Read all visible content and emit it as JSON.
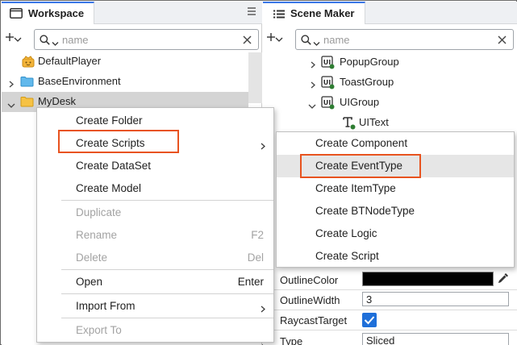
{
  "workspace": {
    "tab_label": "Workspace",
    "search_placeholder": "name",
    "tree": [
      {
        "label": "DefaultPlayer",
        "icon": "player-icon",
        "expandable": false
      },
      {
        "label": "BaseEnvironment",
        "icon": "folder-blue-icon",
        "expandable": true,
        "expanded": false
      },
      {
        "label": "MyDesk",
        "icon": "folder-yellow-icon",
        "expandable": true,
        "expanded": true,
        "selected": true
      }
    ]
  },
  "scene_maker": {
    "tab_label": "Scene Maker",
    "search_placeholder": "name",
    "tree": [
      {
        "label": "PopupGroup",
        "icon": "ui-group-icon",
        "expanded": false
      },
      {
        "label": "ToastGroup",
        "icon": "ui-group-icon",
        "expanded": false
      },
      {
        "label": "UIGroup",
        "icon": "ui-group-icon",
        "expanded": true
      },
      {
        "label": "UIText",
        "icon": "ui-text-icon"
      }
    ],
    "properties": [
      {
        "label": "OutlineColor",
        "kind": "color",
        "value": "#000000"
      },
      {
        "label": "OutlineWidth",
        "kind": "number",
        "value": "3"
      },
      {
        "label": "RaycastTarget",
        "kind": "checkbox",
        "checked": true
      },
      {
        "label": "Type",
        "kind": "select",
        "value": "Sliced"
      }
    ]
  },
  "context_menu": {
    "items": [
      {
        "label": "Create Folder",
        "shortcut": "",
        "disabled": false
      },
      {
        "label": "Create Scripts",
        "shortcut": "",
        "disabled": false,
        "submenu": true,
        "highlighted": true
      },
      {
        "label": "Create DataSet",
        "shortcut": "",
        "disabled": false
      },
      {
        "label": "Create Model",
        "shortcut": "",
        "disabled": false
      },
      {
        "label": "Duplicate",
        "shortcut": "",
        "disabled": true
      },
      {
        "label": "Rename",
        "shortcut": "F2",
        "disabled": true
      },
      {
        "label": "Delete",
        "shortcut": "Del",
        "disabled": true
      },
      {
        "label": "Open",
        "shortcut": "Enter",
        "disabled": false
      },
      {
        "label": "Import From",
        "shortcut": "",
        "disabled": false,
        "submenu": true
      },
      {
        "label": "Export To",
        "shortcut": "",
        "disabled": true
      }
    ]
  },
  "scripts_submenu": {
    "items": [
      {
        "label": "Create Component"
      },
      {
        "label": "Create EventType",
        "highlighted": true
      },
      {
        "label": "Create ItemType"
      },
      {
        "label": "Create BTNodeType"
      },
      {
        "label": "Create Logic"
      },
      {
        "label": "Create Script"
      }
    ]
  },
  "colors": {
    "accent": "#3b78e7",
    "highlight_border": "#e8531f",
    "checkbox": "#1e6fd9",
    "ui_group_icon": "#2e7d32"
  }
}
